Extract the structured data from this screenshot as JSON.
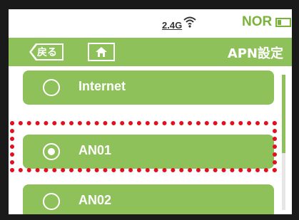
{
  "status": {
    "band": "2.4G",
    "mode": "NOR",
    "icons": [
      "wifi-signal-icon",
      "battery-icon"
    ]
  },
  "header": {
    "back_label": "戻る",
    "home_icon": "home-icon",
    "title": "APN設定"
  },
  "apn_list": [
    {
      "label": "Internet",
      "selected": false
    },
    {
      "label": "AN01",
      "selected": true
    },
    {
      "label": "AN02",
      "selected": false
    }
  ],
  "colors": {
    "accent": "#8ec159",
    "mode_text": "#7ab33a",
    "highlight": "#e0101e"
  }
}
